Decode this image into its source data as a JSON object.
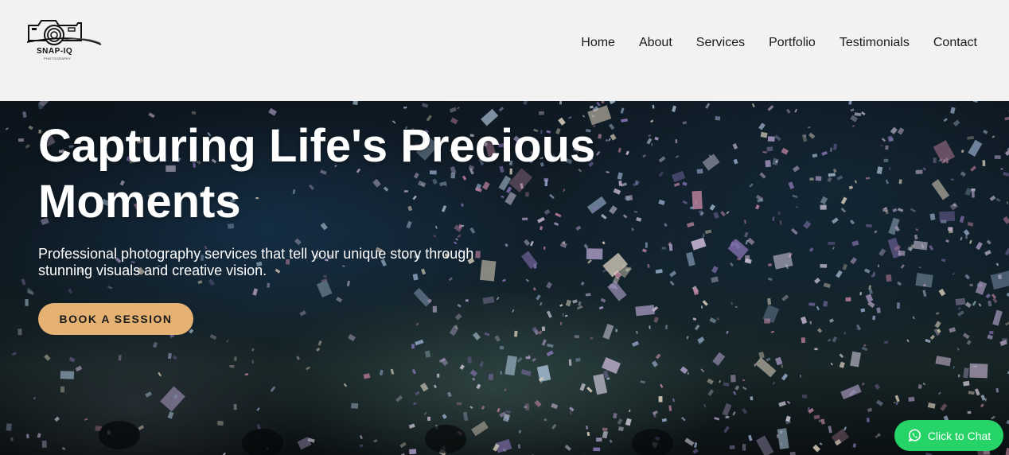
{
  "brand": {
    "name": "SNAP-IQ",
    "tagline": "PHOTOGRAPHY",
    "logo_icon": "camera-icon"
  },
  "nav": {
    "items": [
      {
        "label": "Home"
      },
      {
        "label": "About"
      },
      {
        "label": "Services"
      },
      {
        "label": "Portfolio"
      },
      {
        "label": "Testimonials"
      },
      {
        "label": "Contact"
      }
    ]
  },
  "hero": {
    "title_line1": "Capturing Life's Precious",
    "title_line2": "Moments",
    "subtitle": "Professional photography services that tell your unique story through stunning visuals and creative vision.",
    "cta_label": "BOOK A SESSION"
  },
  "chat": {
    "label": "Click to Chat",
    "icon": "whatsapp-icon"
  },
  "colors": {
    "header_bg": "#f2f2f2",
    "accent": "#e6b273",
    "chat_green": "#25d366",
    "text_dark": "#1a1a1a"
  }
}
